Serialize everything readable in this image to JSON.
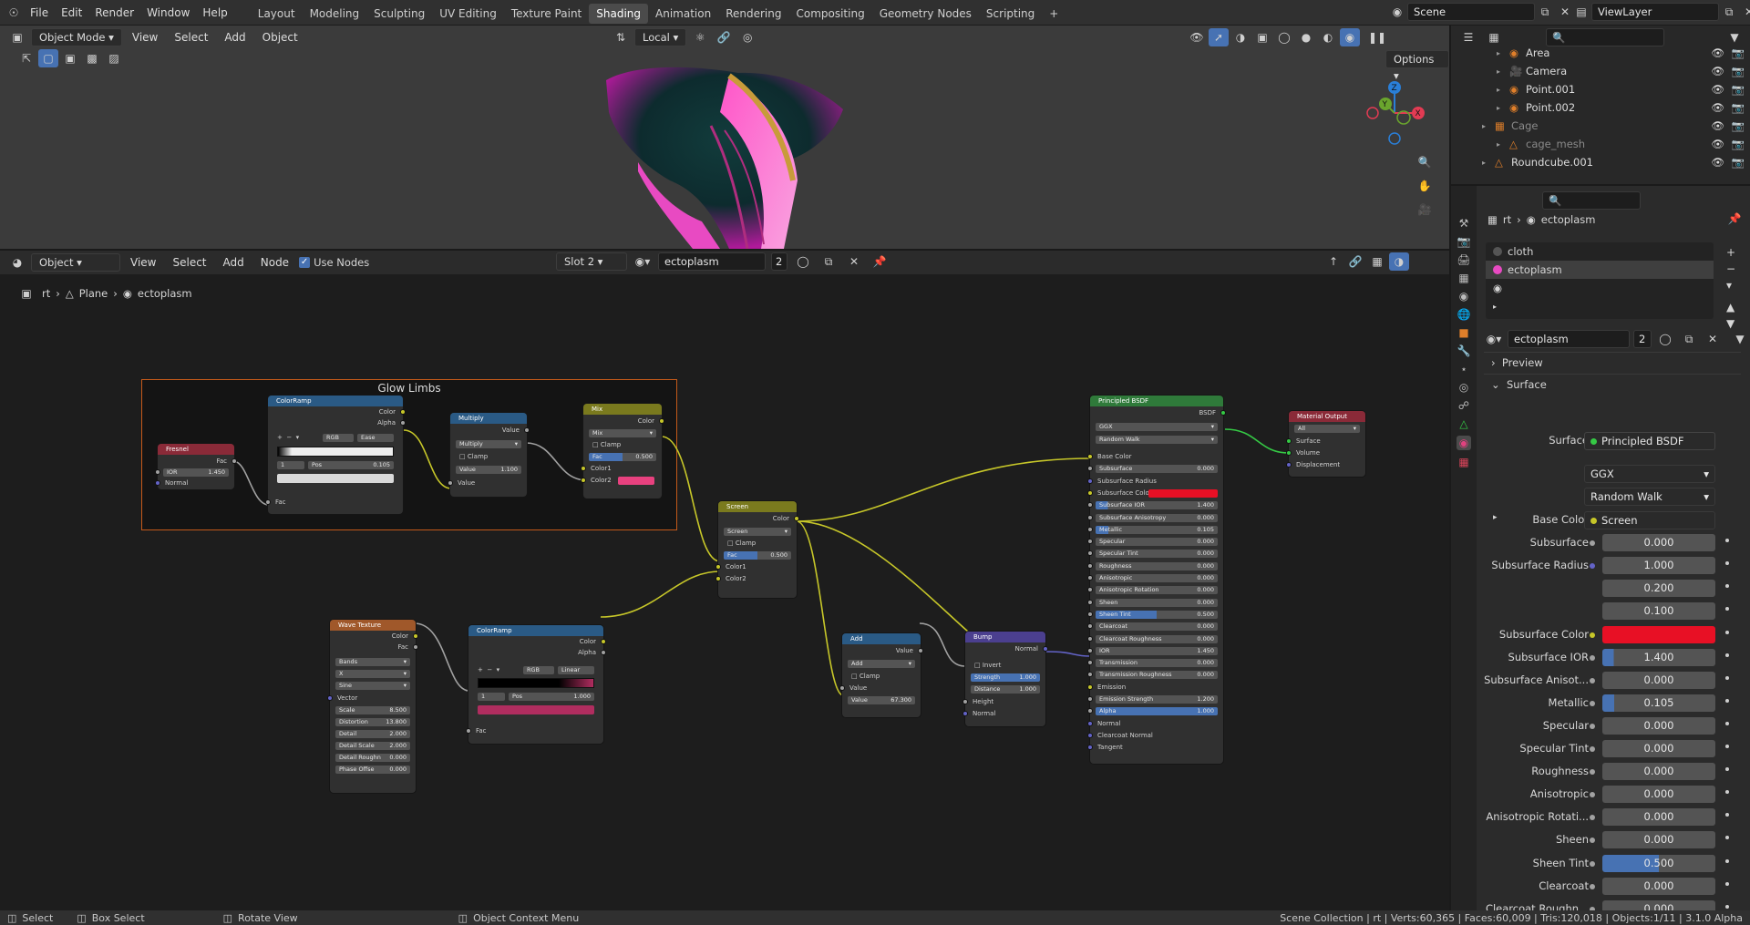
{
  "topbar": {
    "menus": [
      "File",
      "Edit",
      "Render",
      "Window",
      "Help"
    ],
    "workspaces": [
      "Layout",
      "Modeling",
      "Sculpting",
      "UV Editing",
      "Texture Paint",
      "Shading",
      "Animation",
      "Rendering",
      "Compositing",
      "Geometry Nodes",
      "Scripting"
    ],
    "active_workspace": "Shading",
    "scene": "Scene",
    "view_layer": "ViewLayer"
  },
  "viewport": {
    "mode": "Object Mode",
    "menus": [
      "View",
      "Select",
      "Add",
      "Object"
    ],
    "transform_orientation": "Local",
    "options": "Options"
  },
  "node_editor": {
    "editor_type": "Object",
    "menus": [
      "View",
      "Select",
      "Add",
      "Node"
    ],
    "use_nodes_label": "Use Nodes",
    "slot": "Slot 2",
    "material": "ectoplasm",
    "user_count": "2",
    "breadcrumb": [
      "rt",
      "Plane",
      "ectoplasm"
    ],
    "frame_label": "Glow Limbs",
    "nodes": {
      "fresnel": {
        "title": "Fresnel",
        "out": "Fac",
        "ior_label": "IOR",
        "ior": "1.450",
        "normal": "Normal"
      },
      "colorramp1": {
        "title": "ColorRamp",
        "out1": "Color",
        "out2": "Alpha",
        "mode": "RGB",
        "interp": "Ease",
        "index": "1",
        "pos_label": "Pos",
        "pos": "0.105",
        "in": "Fac"
      },
      "multiply": {
        "title": "Multiply",
        "out": "Value",
        "op": "Multiply",
        "clamp": "Clamp",
        "val_label": "Value",
        "val": "1.100",
        "in": "Value"
      },
      "mix": {
        "title": "Mix",
        "out": "Color",
        "mode": "Mix",
        "clamp": "Clamp",
        "fac_label": "Fac",
        "fac": "0.500",
        "c1": "Color1",
        "c2": "Color2"
      },
      "screen": {
        "title": "Screen",
        "out": "Color",
        "mode": "Screen",
        "clamp": "Clamp",
        "fac_label": "Fac",
        "fac": "0.500",
        "c1": "Color1",
        "c2": "Color2"
      },
      "wave": {
        "title": "Wave Texture",
        "out1": "Color",
        "out2": "Fac",
        "type": "Bands",
        "dir": "X",
        "profile": "Sine",
        "vector": "Vector",
        "fields": [
          [
            "Scale",
            "8.500"
          ],
          [
            "Distortion",
            "13.800"
          ],
          [
            "Detail",
            "2.000"
          ],
          [
            "Detail Scale",
            "2.000"
          ],
          [
            "Detail Roughn",
            "0.000"
          ],
          [
            "Phase Offse",
            "0.000"
          ]
        ]
      },
      "colorramp2": {
        "title": "ColorRamp",
        "out1": "Color",
        "out2": "Alpha",
        "mode": "RGB",
        "interp": "Linear",
        "index": "1",
        "pos_label": "Pos",
        "pos": "1.000",
        "in": "Fac"
      },
      "add": {
        "title": "Add",
        "out": "Value",
        "op": "Add",
        "clamp": "Clamp",
        "in": "Value",
        "val_label": "Value",
        "val": "67.300"
      },
      "bump": {
        "title": "Bump",
        "out": "Normal",
        "invert": "Invert",
        "strength_label": "Strength",
        "strength": "1.000",
        "distance_label": "Distance",
        "distance": "1.000",
        "height": "Height",
        "normal": "Normal"
      },
      "bsdf": {
        "title": "Principled BSDF",
        "out": "BSDF",
        "dist": "GGX",
        "sss": "Random Walk",
        "rows": [
          [
            "Base Color",
            ""
          ],
          [
            "Subsurface",
            "0.000"
          ],
          [
            "Subsurface Radius",
            ""
          ],
          [
            "Subsurface Colo",
            ""
          ],
          [
            "Subsurface IOR",
            "1.400"
          ],
          [
            "Subsurface Anisotropy",
            "0.000"
          ],
          [
            "Metallic",
            "0.105"
          ],
          [
            "Specular",
            "0.000"
          ],
          [
            "Specular Tint",
            "0.000"
          ],
          [
            "Roughness",
            "0.000"
          ],
          [
            "Anisotropic",
            "0.000"
          ],
          [
            "Anisotropic Rotation",
            "0.000"
          ],
          [
            "Sheen",
            "0.000"
          ],
          [
            "Sheen Tint",
            "0.500"
          ],
          [
            "Clearcoat",
            "0.000"
          ],
          [
            "Clearcoat Roughness",
            "0.000"
          ],
          [
            "IOR",
            "1.450"
          ],
          [
            "Transmission",
            "0.000"
          ],
          [
            "Transmission Roughness",
            "0.000"
          ],
          [
            "Emission",
            ""
          ],
          [
            "Emission Strength",
            "1.200"
          ],
          [
            "Alpha",
            "1.000"
          ],
          [
            "Normal",
            ""
          ],
          [
            "Clearcoat Normal",
            ""
          ],
          [
            "Tangent",
            ""
          ]
        ]
      },
      "output": {
        "title": "Material Output",
        "target": "All",
        "surface": "Surface",
        "volume": "Volume",
        "displacement": "Displacement"
      }
    }
  },
  "outliner": {
    "items": [
      {
        "name": "Area",
        "indent": 2
      },
      {
        "name": "Camera",
        "indent": 2
      },
      {
        "name": "Point.001",
        "indent": 2
      },
      {
        "name": "Point.002",
        "indent": 2
      },
      {
        "name": "Cage",
        "indent": 1
      },
      {
        "name": "cage_mesh",
        "indent": 2
      },
      {
        "name": "Roundcube.001",
        "indent": 1
      }
    ]
  },
  "properties": {
    "breadcrumb": [
      "rt",
      "ectoplasm"
    ],
    "slots": [
      "cloth",
      "ectoplasm"
    ],
    "material_name": "ectoplasm",
    "user_count": "2",
    "preview_label": "Preview",
    "surface_panel": "Surface",
    "surface_label": "Surface",
    "surface_value": "Principled BSDF",
    "distribution": "GGX",
    "subsurface_method": "Random Walk",
    "rows": [
      {
        "label": "Base Color",
        "value": "Screen",
        "kind": "link"
      },
      {
        "label": "Subsurface",
        "value": "0.000"
      },
      {
        "label": "Subsurface Radius",
        "value": "1.000"
      },
      {
        "label": "",
        "value": "0.200"
      },
      {
        "label": "",
        "value": "0.100"
      },
      {
        "label": "Subsurface Color",
        "value": "",
        "kind": "color"
      },
      {
        "label": "Subsurface IOR",
        "value": "1.400",
        "fill": 0.1
      },
      {
        "label": "Subsurface Anisot...",
        "value": "0.000"
      },
      {
        "label": "Metallic",
        "value": "0.105",
        "fill": 0.105
      },
      {
        "label": "Specular",
        "value": "0.000"
      },
      {
        "label": "Specular Tint",
        "value": "0.000"
      },
      {
        "label": "Roughness",
        "value": "0.000"
      },
      {
        "label": "Anisotropic",
        "value": "0.000"
      },
      {
        "label": "Anisotropic Rotati...",
        "value": "0.000"
      },
      {
        "label": "Sheen",
        "value": "0.000"
      },
      {
        "label": "Sheen Tint",
        "value": "0.500",
        "fill": 0.5
      },
      {
        "label": "Clearcoat",
        "value": "0.000"
      },
      {
        "label": "Clearcoat Roughn...",
        "value": "0.000"
      }
    ]
  },
  "statusbar": {
    "select": "Select",
    "box_select": "Box Select",
    "rotate_view": "Rotate View",
    "context_menu": "Object Context Menu",
    "stats": "Scene Collection | rt | Verts:60,365 | Faces:60,009 | Tris:120,018 | Objects:1/11 | 3.1.0 Alpha"
  },
  "colors": {
    "accent": "#4772b3",
    "frame_border": "#c45a1a",
    "subsurface_color": "#e81025",
    "mix_color2": "#e8417f"
  }
}
